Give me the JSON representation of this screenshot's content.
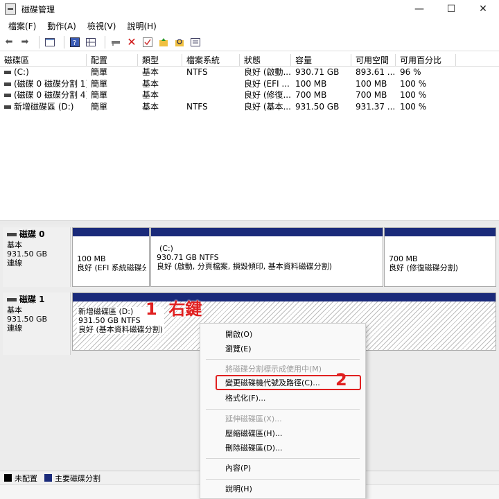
{
  "window": {
    "title": "磁碟管理",
    "min": "—",
    "max": "☐",
    "close": "✕"
  },
  "menu": [
    "檔案(F)",
    "動作(A)",
    "檢視(V)",
    "說明(H)"
  ],
  "volumes": {
    "columns": [
      "磁碟區",
      "配置",
      "類型",
      "檔案系統",
      "狀態",
      "容量",
      "可用空間",
      "可用百分比"
    ],
    "rows": [
      [
        "(C:)",
        "簡單",
        "基本",
        "NTFS",
        "良好 (啟動...",
        "930.71 GB",
        "893.61 ...",
        "96 %"
      ],
      [
        "(磁碟 0 磁碟分割 1)",
        "簡單",
        "基本",
        "",
        "良好 (EFI ...",
        "100 MB",
        "100 MB",
        "100 %"
      ],
      [
        "(磁碟 0 磁碟分割 4)",
        "簡單",
        "基本",
        "",
        "良好 (修復...",
        "700 MB",
        "700 MB",
        "100 %"
      ],
      [
        "新增磁碟區 (D:)",
        "簡單",
        "基本",
        "NTFS",
        "良好 (基本...",
        "931.50 GB",
        "931.37 ...",
        "100 %"
      ]
    ]
  },
  "disks": [
    {
      "name": "磁碟 0",
      "type": "基本",
      "size": "931.50 GB",
      "status": "連線",
      "partitions": [
        {
          "line1": "",
          "line2": "100 MB",
          "line3": "良好 (EFI 系統磁碟分割)"
        },
        {
          "line1": "(C:)",
          "line2": "930.71 GB NTFS",
          "line3": "良好 (啟動, 分頁檔案, 損毀傾印, 基本資料磁碟分割)"
        },
        {
          "line1": "",
          "line2": "700 MB",
          "line3": "良好 (修復磁碟分割)"
        }
      ]
    },
    {
      "name": "磁碟 1",
      "type": "基本",
      "size": "931.50 GB",
      "status": "連線",
      "partitions": [
        {
          "line1": "新增磁碟區 (D:)",
          "line2": "931.50 GB NTFS",
          "line3": "良好 (基本資料磁碟分割)"
        }
      ]
    }
  ],
  "legend": {
    "unallocated": "未配置",
    "primary": "主要磁碟分割"
  },
  "context_menu": [
    {
      "label": "開啟(O)",
      "enabled": true
    },
    {
      "label": "瀏覽(E)",
      "enabled": true
    },
    {
      "label": "將磁碟分割標示成使用中(M)",
      "enabled": false
    },
    {
      "label": "變更磁碟機代號及路徑(C)...",
      "enabled": true
    },
    {
      "label": "格式化(F)...",
      "enabled": true
    },
    {
      "label": "延伸磁碟區(X)...",
      "enabled": false
    },
    {
      "label": "壓縮磁碟區(H)...",
      "enabled": true
    },
    {
      "label": "刪除磁碟區(D)...",
      "enabled": true
    },
    {
      "label": "內容(P)",
      "enabled": true
    },
    {
      "label": "說明(H)",
      "enabled": true
    }
  ],
  "annotations": {
    "step1": "1  右鍵",
    "step2": "2"
  },
  "colors": {
    "primary_partition": "#1a2a7a",
    "annotation": "#e02020",
    "unallocated": "#000000"
  }
}
